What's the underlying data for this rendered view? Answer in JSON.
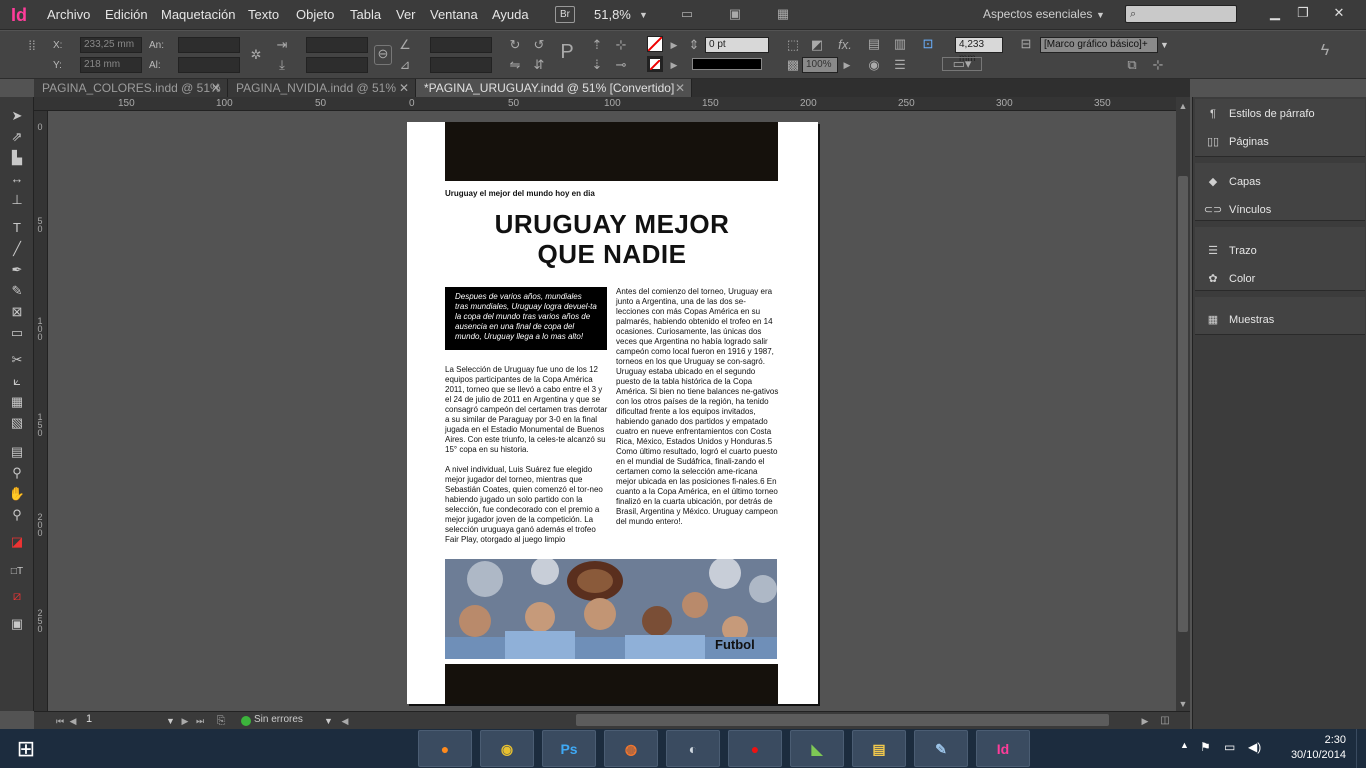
{
  "app": {
    "logo": "Id",
    "brand_color": "#ff3c9a"
  },
  "menu": [
    "Archivo",
    "Edición",
    "Maquetación",
    "Texto",
    "Objeto",
    "Tabla",
    "Ver",
    "Ventana",
    "Ayuda"
  ],
  "menubar": {
    "br_label": "Br",
    "zoom": "51,8%",
    "workspace": "Aspectos esenciales",
    "search_placeholder": ""
  },
  "control": {
    "x_label": "X:",
    "x_value": "233,25 mm",
    "y_label": "Y:",
    "y_value": "218 mm",
    "w_label": "An:",
    "h_label": "Al:",
    "stroke_weight": "0 pt",
    "opacity": "100%",
    "fit_value": "4,233 mm",
    "frame_style": "[Marco gráfico básico]+"
  },
  "tabs": [
    {
      "label": "PAGINA_COLORES.indd @ 51%",
      "active": false
    },
    {
      "label": "PAGINA_NVIDIA.indd @ 51%",
      "active": false
    },
    {
      "label": "*PAGINA_URUGUAY.indd @ 51% [Convertido]",
      "active": true
    }
  ],
  "ruler": {
    "h_ticks": [
      "150",
      "100",
      "50",
      "0",
      "50",
      "100",
      "150",
      "200",
      "250",
      "300",
      "350"
    ],
    "v_ticks": [
      "0",
      "5 0",
      "1 0 0",
      "1 5 0",
      "2 0 0",
      "2 5 0"
    ]
  },
  "document": {
    "kicker": "Uruguay el mejor del mundo hoy en dia",
    "headline_1": "URUGUAY MEJOR",
    "headline_2": "QUE NADIE",
    "quote": "Despues de varios años, mundiales tras mundiales, Uruguay logra devuel-ta la copa del mundo tras varios años de ausencia en una final de copa del mundo, Uruguay llega a lo mas alto!",
    "left_p1": "La Selección de Uruguay fue uno de los 12 equipos participantes de la Copa América 2011, torneo que se llevó a cabo entre el 3 y el 24 de julio de 2011 en Argentina y que se consagró campeón del certamen tras derrotar a su similar de Paraguay por 3-0 en la final jugada en el Estadio Monumental de Buenos Aires. Con este triunfo, la celes-te alcanzó su 15° copa en su historia.",
    "left_p2": "A nivel individual, Luis Suárez fue elegido mejor jugador del torneo, mientras que Sebastián Coates, quien comenzó el tor-neo habiendo jugado un solo partido con la selección, fue condecorado con el premio a mejor jugador joven de la competición. La selección uruguaya ganó además el trofeo Fair Play, otorgado al juego limpio",
    "right_p1": "Antes del comienzo del torneo, Uruguay era junto a Argentina, una de las dos se-lecciones con más Copas América en su palmarés, habiendo obtenido el trofeo en 14 ocasiones. Curiosamente, las únicas dos veces que Argentina no había logrado salir campeón como local fueron en 1916 y 1987, torneos en los que Uruguay se con-sagró.",
    "right_p2": "Uruguay estaba ubicado en el segundo puesto de la tabla histórica de la Copa América. Si bien no tiene balances ne-gativos con los otros países de la región, ha tenido dificultad frente a los equipos invitados, habiendo ganado dos partidos y empatado cuatro en nueve enfrentamientos con Costa Rica, México, Estados Unidos y Honduras.5",
    "right_p3": "Como último resultado, logró el cuarto puesto en el mundial de Sudáfrica, finali-zando el certamen como la selección ame-ricana mejor ubicada en las posiciones fi-nales.6 En cuanto a la Copa América, en el último torneo finalizó en la cuarta ubicación, por detrás de Brasil, Argentina y México. Uruguay campeon del mundo entero!."
  },
  "status": {
    "page": "1",
    "errors": "Sin errores",
    "ok_color": "#3cb43c"
  },
  "panels": [
    {
      "label": "Estilos de párrafo",
      "icon": "paragraph-styles-icon"
    },
    {
      "label": "Páginas",
      "icon": "pages-icon"
    },
    {
      "label": "Capas",
      "icon": "layers-icon"
    },
    {
      "label": "Vínculos",
      "icon": "links-icon"
    },
    {
      "label": "Trazo",
      "icon": "stroke-icon"
    },
    {
      "label": "Color",
      "icon": "color-icon"
    },
    {
      "label": "Muestras",
      "icon": "swatches-icon"
    }
  ],
  "taskbar": {
    "apps": [
      "firefox-icon",
      "chrome-icon",
      "photoshop-icon",
      "origin-icon",
      "steam-icon",
      "record-icon",
      "grapher-icon",
      "explorer-icon",
      "paint-icon",
      "indesign-icon"
    ],
    "ps_label": "Ps",
    "id_label": "Id",
    "time": "2:30",
    "date": "30/10/2014"
  }
}
